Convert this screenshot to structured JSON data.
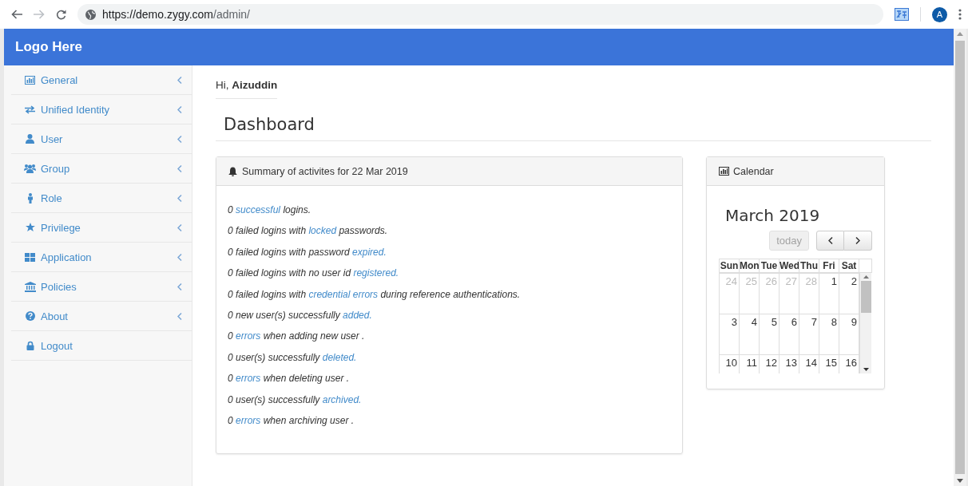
{
  "browser": {
    "url_host": "https://demo.zygy.com",
    "url_path": "/admin/",
    "avatar": "A"
  },
  "header": {
    "logo": "Logo Here"
  },
  "sidebar": {
    "items": [
      {
        "label": "General",
        "expandable": true
      },
      {
        "label": "Unified Identity",
        "expandable": true
      },
      {
        "label": "User",
        "expandable": true
      },
      {
        "label": "Group",
        "expandable": true
      },
      {
        "label": "Role",
        "expandable": true
      },
      {
        "label": "Privilege",
        "expandable": true
      },
      {
        "label": "Application",
        "expandable": true
      },
      {
        "label": "Policies",
        "expandable": true
      },
      {
        "label": "About",
        "expandable": true
      },
      {
        "label": "Logout",
        "expandable": false
      }
    ]
  },
  "greeting": {
    "prefix": "Hi,",
    "name": "Aizuddin"
  },
  "page_title": "Dashboard",
  "summary": {
    "title": "Summary of activites for 22 Mar 2019",
    "lines": [
      [
        {
          "text": "0 "
        },
        {
          "text": "successful",
          "link": true
        },
        {
          "text": " logins."
        }
      ],
      [
        {
          "text": "0 failed logins with "
        },
        {
          "text": "locked",
          "link": true
        },
        {
          "text": " passwords."
        }
      ],
      [
        {
          "text": "0 failed logins with password "
        },
        {
          "text": "expired.",
          "link": true
        }
      ],
      [
        {
          "text": "0 failed logins with no user id "
        },
        {
          "text": "registered.",
          "link": true
        }
      ],
      [
        {
          "text": "0 failed logins with "
        },
        {
          "text": "credential errors",
          "link": true
        },
        {
          "text": " during reference authentications."
        }
      ],
      [
        {
          "text": "0 new user(s) successfully "
        },
        {
          "text": "added.",
          "link": true
        }
      ],
      [
        {
          "text": "0 "
        },
        {
          "text": "errors",
          "link": true
        },
        {
          "text": " when adding new user ."
        }
      ],
      [
        {
          "text": "0 user(s) successfully "
        },
        {
          "text": "deleted.",
          "link": true
        }
      ],
      [
        {
          "text": "0 "
        },
        {
          "text": "errors",
          "link": true
        },
        {
          "text": " when deleting user ."
        }
      ],
      [
        {
          "text": "0 user(s) successfully "
        },
        {
          "text": "archived.",
          "link": true
        }
      ],
      [
        {
          "text": "0 "
        },
        {
          "text": "errors",
          "link": true
        },
        {
          "text": " when archiving user ."
        }
      ]
    ]
  },
  "calendar": {
    "title": "Calendar",
    "month": "March 2019",
    "today_button": {
      "label": "today",
      "disabled": true
    },
    "weekdays": [
      "Sun",
      "Mon",
      "Tue",
      "Wed",
      "Thu",
      "Fri",
      "Sat"
    ],
    "weeks": [
      [
        {
          "day": "24",
          "other_month": true
        },
        {
          "day": "25",
          "other_month": true
        },
        {
          "day": "26",
          "other_month": true
        },
        {
          "day": "27",
          "other_month": true
        },
        {
          "day": "28",
          "other_month": true
        },
        {
          "day": "1",
          "other_month": false
        },
        {
          "day": "2",
          "other_month": false
        }
      ],
      [
        {
          "day": "3",
          "other_month": false
        },
        {
          "day": "4",
          "other_month": false
        },
        {
          "day": "5",
          "other_month": false
        },
        {
          "day": "6",
          "other_month": false
        },
        {
          "day": "7",
          "other_month": false
        },
        {
          "day": "8",
          "other_month": false
        },
        {
          "day": "9",
          "other_month": false
        }
      ],
      [
        {
          "day": "10",
          "other_month": false
        },
        {
          "day": "11",
          "other_month": false
        },
        {
          "day": "12",
          "other_month": false
        },
        {
          "day": "13",
          "other_month": false
        },
        {
          "day": "14",
          "other_month": false
        },
        {
          "day": "15",
          "other_month": false
        },
        {
          "day": "16",
          "other_month": false
        }
      ]
    ]
  }
}
